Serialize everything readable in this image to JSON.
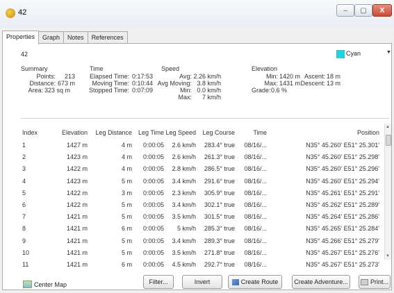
{
  "window": {
    "title": "42",
    "minimize": "–",
    "maximize": "▢",
    "close": "X"
  },
  "tabs": [
    "Properties",
    "Graph",
    "Notes",
    "References"
  ],
  "header": {
    "name": "42",
    "color": "Cyan",
    "color_hex": "#12d9ea"
  },
  "summary": {
    "heading": "Summary",
    "points_label": "Points:",
    "points": "213",
    "distance_label": "Distance:",
    "distance": "673 m",
    "area_label": "Area:",
    "area": "323 sq m"
  },
  "time": {
    "heading": "Time",
    "elapsed_label": "Elapsed Time:",
    "elapsed": "0:17:53",
    "moving_label": "Moving Time:",
    "moving": "0:10:44",
    "stopped_label": "Stopped Time:",
    "stopped": "0:07:09"
  },
  "speed": {
    "heading": "Speed",
    "avg_label": "Avg:",
    "avg": "2.26 km/h",
    "avg_moving_label": "Avg Moving:",
    "avg_moving": "3.8 km/h",
    "min_label": "Min:",
    "min": "0.0 km/h",
    "max_label": "Max:",
    "max": "7 km/h"
  },
  "elevation": {
    "heading": "Elevation",
    "min_label": "Min:",
    "min": "1420 m",
    "max_label": "Max:",
    "max": "1431 m",
    "grade_label": "Grade:",
    "grade": "0.6 %",
    "ascent_label": "Ascent:",
    "ascent": "18 m",
    "descent_label": "Descent:",
    "descent": "13 m"
  },
  "table": {
    "columns": [
      "Index",
      "Elevation",
      "Leg Distance",
      "Leg Time",
      "Leg Speed",
      "Leg Course",
      "Time",
      "Position"
    ],
    "rows": [
      [
        "1",
        "1427 m",
        "4 m",
        "0:00:05",
        "2.6 km/h",
        "283.4° true",
        "08/16/...",
        "N35° 45.260' E51° 25.301'"
      ],
      [
        "2",
        "1423 m",
        "4 m",
        "0:00:05",
        "2.6 km/h",
        "261.3° true",
        "08/16/...",
        "N35° 45.260' E51° 25.298'"
      ],
      [
        "3",
        "1422 m",
        "4 m",
        "0:00:05",
        "2.8 km/h",
        "286.5° true",
        "08/16/...",
        "N35° 45.260' E51° 25.296'"
      ],
      [
        "4",
        "1423 m",
        "5 m",
        "0:00:05",
        "3.4 km/h",
        "291.6° true",
        "08/16/...",
        "N35° 45.260' E51° 25.294'"
      ],
      [
        "5",
        "1422 m",
        "3 m",
        "0:00:05",
        "2.3 km/h",
        "305.9° true",
        "08/16/...",
        "N35° 45.261' E51° 25.291'"
      ],
      [
        "6",
        "1422 m",
        "5 m",
        "0:00:05",
        "3.4 km/h",
        "302.1° true",
        "08/16/...",
        "N35° 45.262' E51° 25.289'"
      ],
      [
        "7",
        "1421 m",
        "5 m",
        "0:00:05",
        "3.5 km/h",
        "301.5° true",
        "08/16/...",
        "N35° 45.264' E51° 25.286'"
      ],
      [
        "8",
        "1421 m",
        "6 m",
        "0:00:05",
        "5 km/h",
        "285.3° true",
        "08/16/...",
        "N35° 45.265' E51° 25.284'"
      ],
      [
        "9",
        "1421 m",
        "5 m",
        "0:00:05",
        "3.4 km/h",
        "289.3° true",
        "08/16/...",
        "N35° 45.266' E51° 25.279'"
      ],
      [
        "10",
        "1421 m",
        "5 m",
        "0:00:05",
        "3.5 km/h",
        "271.8° true",
        "08/16/...",
        "N35° 45.267' E51° 25.276'"
      ],
      [
        "11",
        "1421 m",
        "6 m",
        "0:00:05",
        "4.5 km/h",
        "292.7° true",
        "08/16/...",
        "N35° 45.267' E51° 25.273'"
      ]
    ]
  },
  "footer": {
    "center_map": "Center Map",
    "filter": "Filter...",
    "invert": "Invert",
    "create_route": "Create Route",
    "create_adventure": "Create Adventure...",
    "print": "Print..."
  }
}
